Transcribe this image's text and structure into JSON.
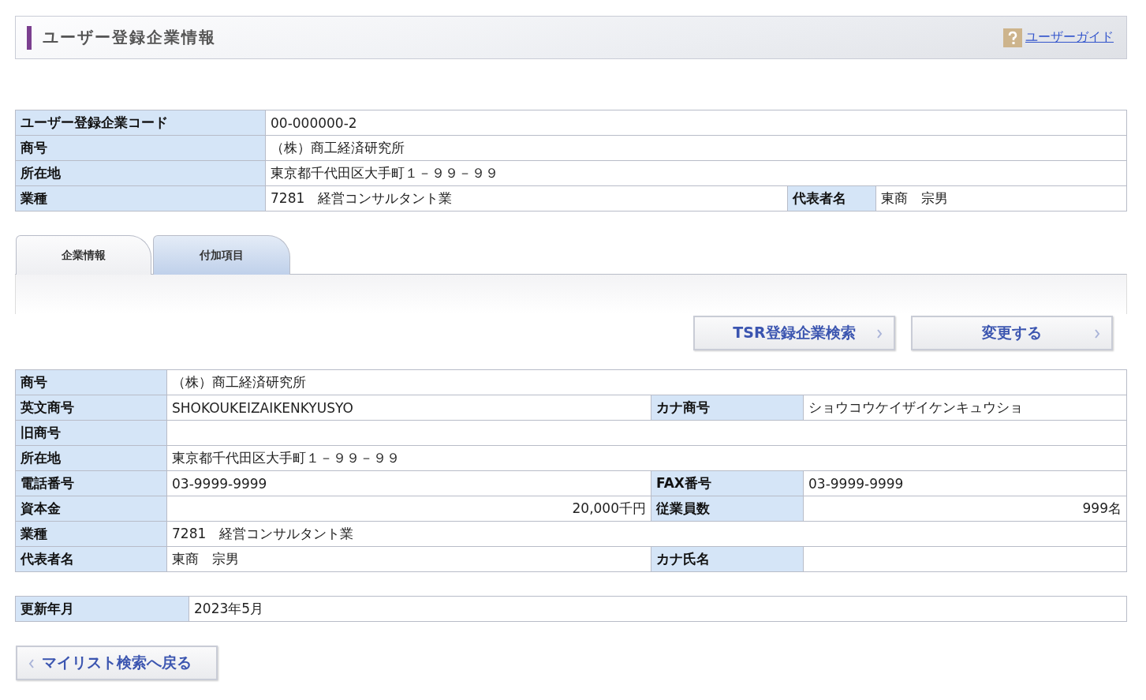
{
  "header": {
    "title": "ユーザー登録企業情報",
    "guide_link": "ユーザーガイド"
  },
  "summary": {
    "rows": [
      {
        "fields": [
          {
            "label": "ユーザー登録企業コード",
            "value": "00-000000-2"
          }
        ]
      },
      {
        "fields": [
          {
            "label": "商号",
            "value": "（株）商工経済研究所"
          }
        ]
      },
      {
        "fields": [
          {
            "label": "所在地",
            "value": "東京都千代田区大手町１－９９－９９"
          }
        ]
      },
      {
        "fields": [
          {
            "label": "業種",
            "value": "7281　経営コンサルタント業"
          },
          {
            "label": "代表者名",
            "value": "東商　宗男"
          }
        ]
      }
    ]
  },
  "tabs": [
    {
      "label": "企業情報",
      "selected": true
    },
    {
      "label": "付加項目",
      "selected": false
    }
  ],
  "actions": [
    "TSR登録企業検索",
    "変更する"
  ],
  "details": {
    "rows": [
      {
        "fields": [
          {
            "label": "商号",
            "value": "（株）商工経済研究所"
          }
        ]
      },
      {
        "fields": [
          {
            "label": "英文商号",
            "value": "SHOKOUKEIZAIKENKYUSYO"
          },
          {
            "label": "カナ商号",
            "value": "ショウコウケイザイケンキュウショ"
          }
        ]
      },
      {
        "fields": [
          {
            "label": "旧商号"
          }
        ]
      },
      {
        "fields": [
          {
            "label": "所在地",
            "value": "東京都千代田区大手町１－９９－９９"
          }
        ]
      },
      {
        "fields": [
          {
            "label": "電話番号",
            "value": "03-9999-9999"
          },
          {
            "label": "FAX番号",
            "value": "03-9999-9999"
          }
        ]
      },
      {
        "fields": [
          {
            "label": "資本金",
            "value": "20,000千円",
            "kind": "amount"
          },
          {
            "label": "従業員数",
            "value": "999名",
            "kind": "amount"
          }
        ]
      },
      {
        "fields": [
          {
            "label": "業種",
            "value": "7281　経営コンサルタント業"
          }
        ]
      },
      {
        "fields": [
          {
            "label": "代表者名",
            "value": "東商　宗男"
          },
          {
            "label": "カナ氏名"
          }
        ]
      }
    ]
  },
  "updated": {
    "fields": [
      {
        "label": "更新年月",
        "value": "2023年5月"
      }
    ]
  },
  "back_button": "マイリスト検索へ戻る"
}
